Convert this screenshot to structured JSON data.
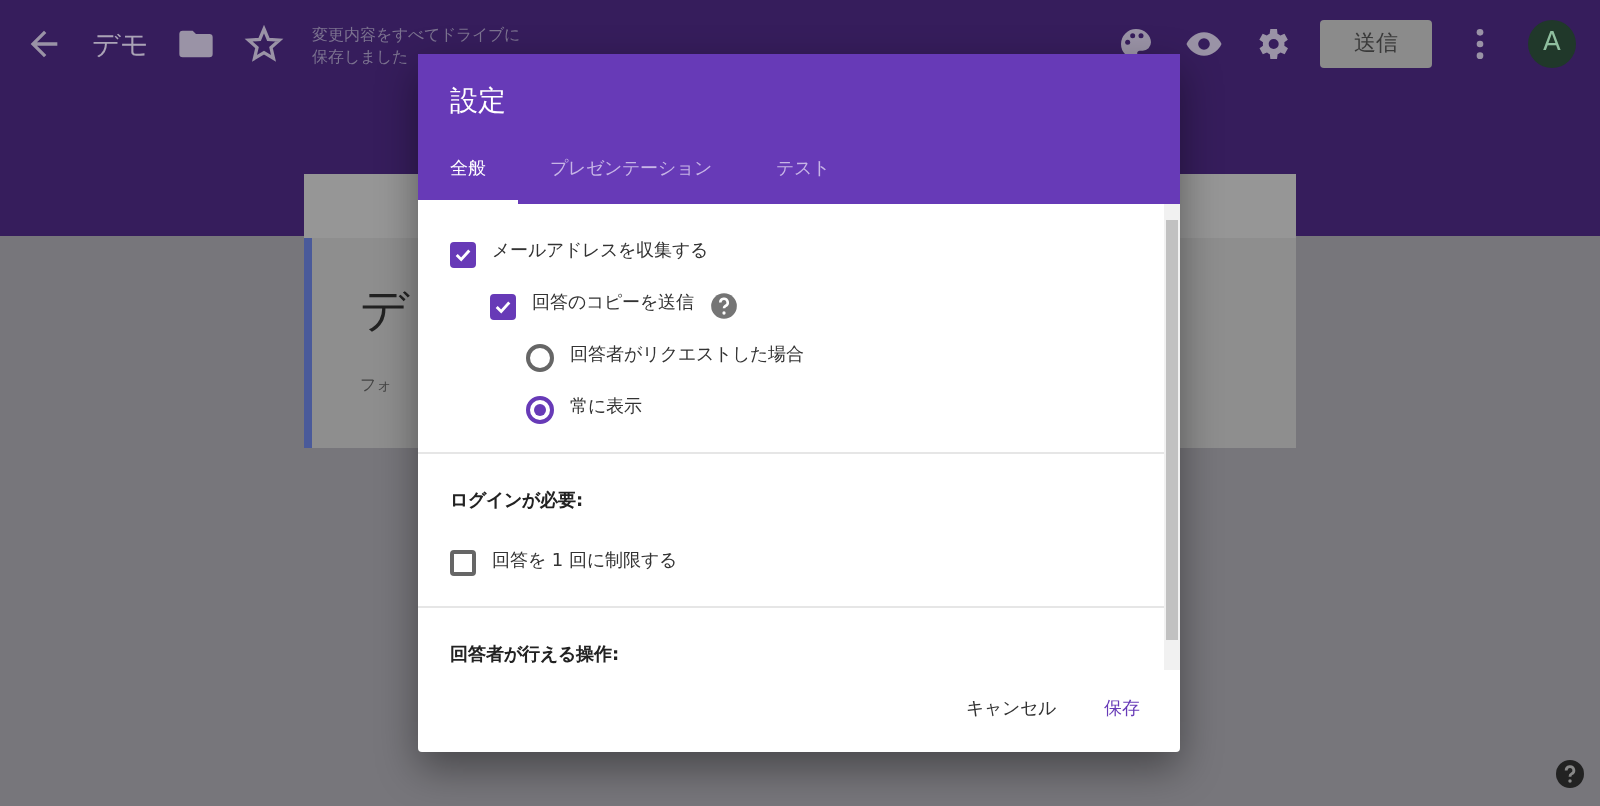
{
  "header": {
    "title": "デモ",
    "save_status": "変更内容をすべてドライブに保存しました",
    "send_button": {
      "label": "送信",
      "disabled": true
    },
    "avatar": "A"
  },
  "form_card": {
    "title": "デ",
    "description": "フォ"
  },
  "dialog": {
    "title": "設定",
    "tabs": [
      {
        "label": "全般",
        "selected": true
      },
      {
        "label": "プレゼンテーション",
        "selected": false
      },
      {
        "label": "テスト",
        "selected": false
      }
    ],
    "sections": [
      {
        "items": [
          {
            "kind": "checkbox",
            "label": "メールアドレスを収集する",
            "checked": true,
            "children": [
              {
                "kind": "checkbox",
                "label": "回答のコピーを送信",
                "checked": true,
                "help": true,
                "children": [
                  {
                    "kind": "radio",
                    "label": "回答者がリクエストした場合",
                    "selected": false
                  },
                  {
                    "kind": "radio",
                    "label": "常に表示",
                    "selected": true
                  }
                ]
              }
            ]
          }
        ]
      },
      {
        "heading": "ログインが必要:",
        "items": [
          {
            "kind": "checkbox",
            "label": "回答を 1 回に制限する",
            "checked": false
          }
        ]
      },
      {
        "heading": "回答者が行える操作:"
      }
    ],
    "buttons": [
      {
        "label": "キャンセル",
        "kind": "text"
      },
      {
        "label": "保存",
        "kind": "primary"
      }
    ]
  }
}
